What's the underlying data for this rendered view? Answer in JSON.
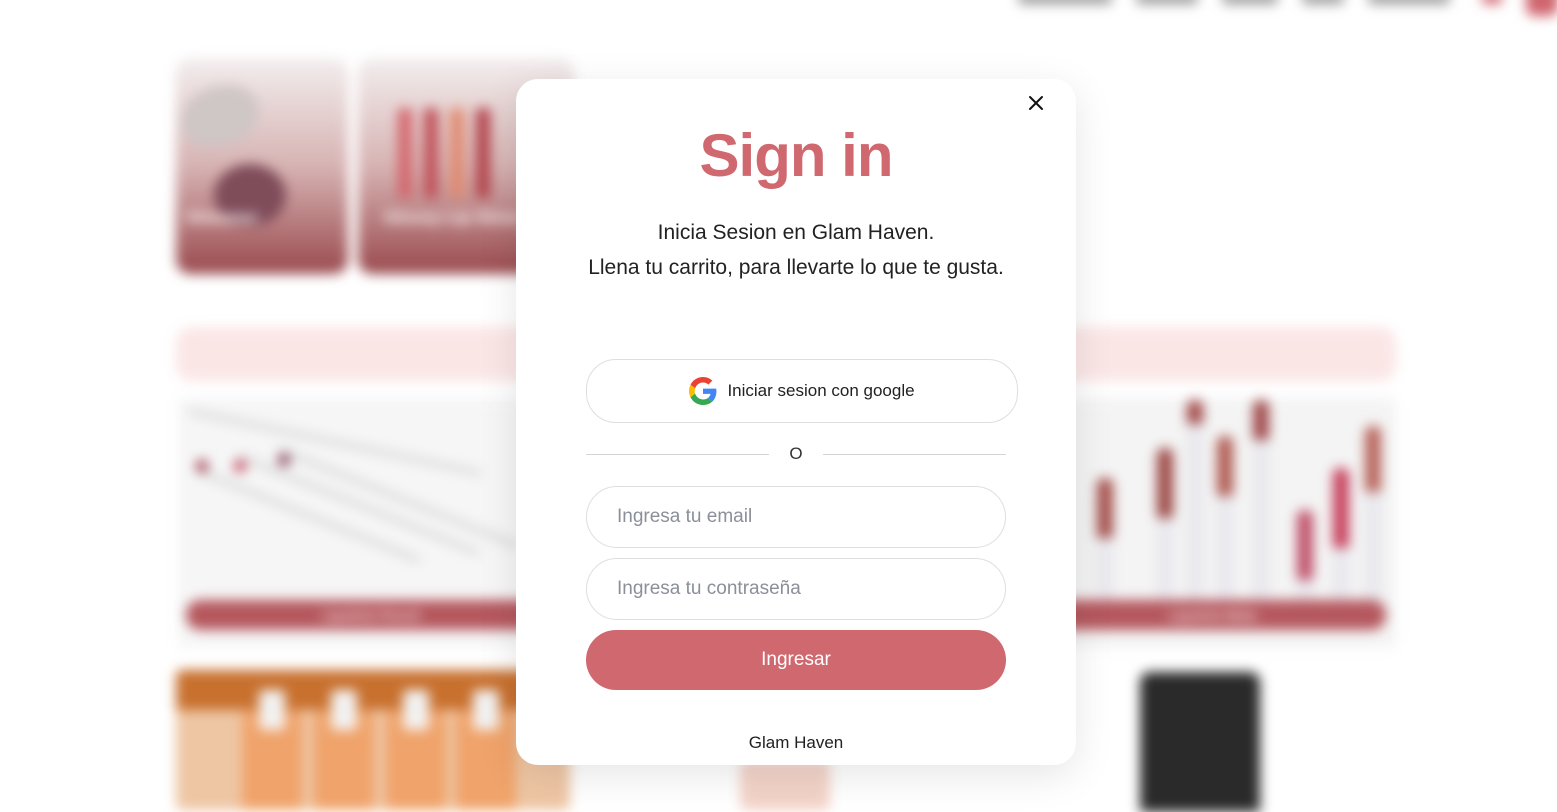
{
  "background": {
    "categories": [
      "Shimmer",
      "Glossy Lip Gloss"
    ],
    "products": [
      "Lipstick Pencil",
      "Lipstick Mate"
    ]
  },
  "modal": {
    "title": "Sign in",
    "subtitle_line1": "Inicia Sesion en Glam Haven.",
    "subtitle_line2": "Llena tu carrito, para llevarte lo que te gusta.",
    "google_button_label": "Iniciar sesion con google",
    "divider_text": "O",
    "email_placeholder": "Ingresa tu email",
    "password_placeholder": "Ingresa tu contraseña",
    "submit_label": "Ingresar",
    "footer_brand": "Glam Haven"
  },
  "colors": {
    "accent": "#d0686f",
    "band": "#fbe6e6",
    "text": "#222222"
  },
  "icons": {
    "close": "close-icon",
    "google": "google-g-icon"
  }
}
